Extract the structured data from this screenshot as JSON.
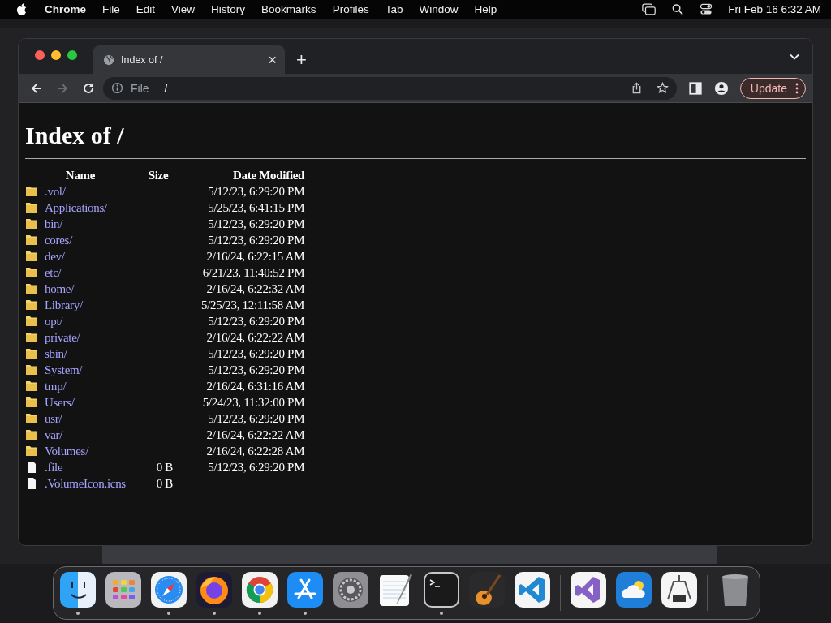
{
  "menu_bar": {
    "app": "Chrome",
    "items": [
      "File",
      "Edit",
      "View",
      "History",
      "Bookmarks",
      "Profiles",
      "Tab",
      "Window",
      "Help"
    ],
    "clock": "Fri Feb 16  6:32 AM"
  },
  "browser": {
    "tab": {
      "title": "Index of /",
      "close": "×"
    },
    "new_tab": "+",
    "forward_disabled": true,
    "address": {
      "scheme": "File",
      "path": "/"
    },
    "update_button": "Update"
  },
  "page": {
    "heading": "Index of /",
    "columns": [
      "Name",
      "Size",
      "Date Modified"
    ],
    "rows": [
      {
        "kind": "folder",
        "name": ".vol/",
        "size": "",
        "date": "5/12/23, 6:29:20 PM"
      },
      {
        "kind": "folder",
        "name": "Applications/",
        "size": "",
        "date": "5/25/23, 6:41:15 PM"
      },
      {
        "kind": "folder",
        "name": "bin/",
        "size": "",
        "date": "5/12/23, 6:29:20 PM"
      },
      {
        "kind": "folder",
        "name": "cores/",
        "size": "",
        "date": "5/12/23, 6:29:20 PM"
      },
      {
        "kind": "folder",
        "name": "dev/",
        "size": "",
        "date": "2/16/24, 6:22:15 AM"
      },
      {
        "kind": "folder",
        "name": "etc/",
        "size": "",
        "date": "6/21/23, 11:40:52 PM"
      },
      {
        "kind": "folder",
        "name": "home/",
        "size": "",
        "date": "2/16/24, 6:22:32 AM"
      },
      {
        "kind": "folder",
        "name": "Library/",
        "size": "",
        "date": "5/25/23, 12:11:58 AM"
      },
      {
        "kind": "folder",
        "name": "opt/",
        "size": "",
        "date": "5/12/23, 6:29:20 PM"
      },
      {
        "kind": "folder",
        "name": "private/",
        "size": "",
        "date": "2/16/24, 6:22:22 AM"
      },
      {
        "kind": "folder",
        "name": "sbin/",
        "size": "",
        "date": "5/12/23, 6:29:20 PM"
      },
      {
        "kind": "folder",
        "name": "System/",
        "size": "",
        "date": "5/12/23, 6:29:20 PM"
      },
      {
        "kind": "folder",
        "name": "tmp/",
        "size": "",
        "date": "2/16/24, 6:31:16 AM"
      },
      {
        "kind": "folder",
        "name": "Users/",
        "size": "",
        "date": "5/24/23, 11:32:00 PM"
      },
      {
        "kind": "folder",
        "name": "usr/",
        "size": "",
        "date": "5/12/23, 6:29:20 PM"
      },
      {
        "kind": "folder",
        "name": "var/",
        "size": "",
        "date": "2/16/24, 6:22:22 AM"
      },
      {
        "kind": "folder",
        "name": "Volumes/",
        "size": "",
        "date": "2/16/24, 6:22:28 AM"
      },
      {
        "kind": "file",
        "name": ".file",
        "size": "0 B",
        "date": "5/12/23, 6:29:20 PM"
      },
      {
        "kind": "file",
        "name": ".VolumeIcon.icns",
        "size": "0 B"
      }
    ]
  },
  "dock": [
    {
      "kind": "finder",
      "running": true
    },
    {
      "kind": "launchpad",
      "running": false
    },
    {
      "kind": "safari",
      "running": true
    },
    {
      "kind": "firefox",
      "running": true
    },
    {
      "kind": "chrome",
      "running": true
    },
    {
      "kind": "appstore",
      "running": true
    },
    {
      "kind": "settings",
      "running": false
    },
    {
      "kind": "textedit",
      "running": false
    },
    {
      "kind": "terminal",
      "running": true
    },
    {
      "kind": "garageband",
      "running": false
    },
    {
      "kind": "vscode",
      "running": false
    },
    {
      "kind": "separator"
    },
    {
      "kind": "visualstudio",
      "running": false
    },
    {
      "kind": "weather",
      "running": false
    },
    {
      "kind": "tool",
      "running": false
    },
    {
      "kind": "separator"
    },
    {
      "kind": "trash",
      "running": false
    }
  ]
}
